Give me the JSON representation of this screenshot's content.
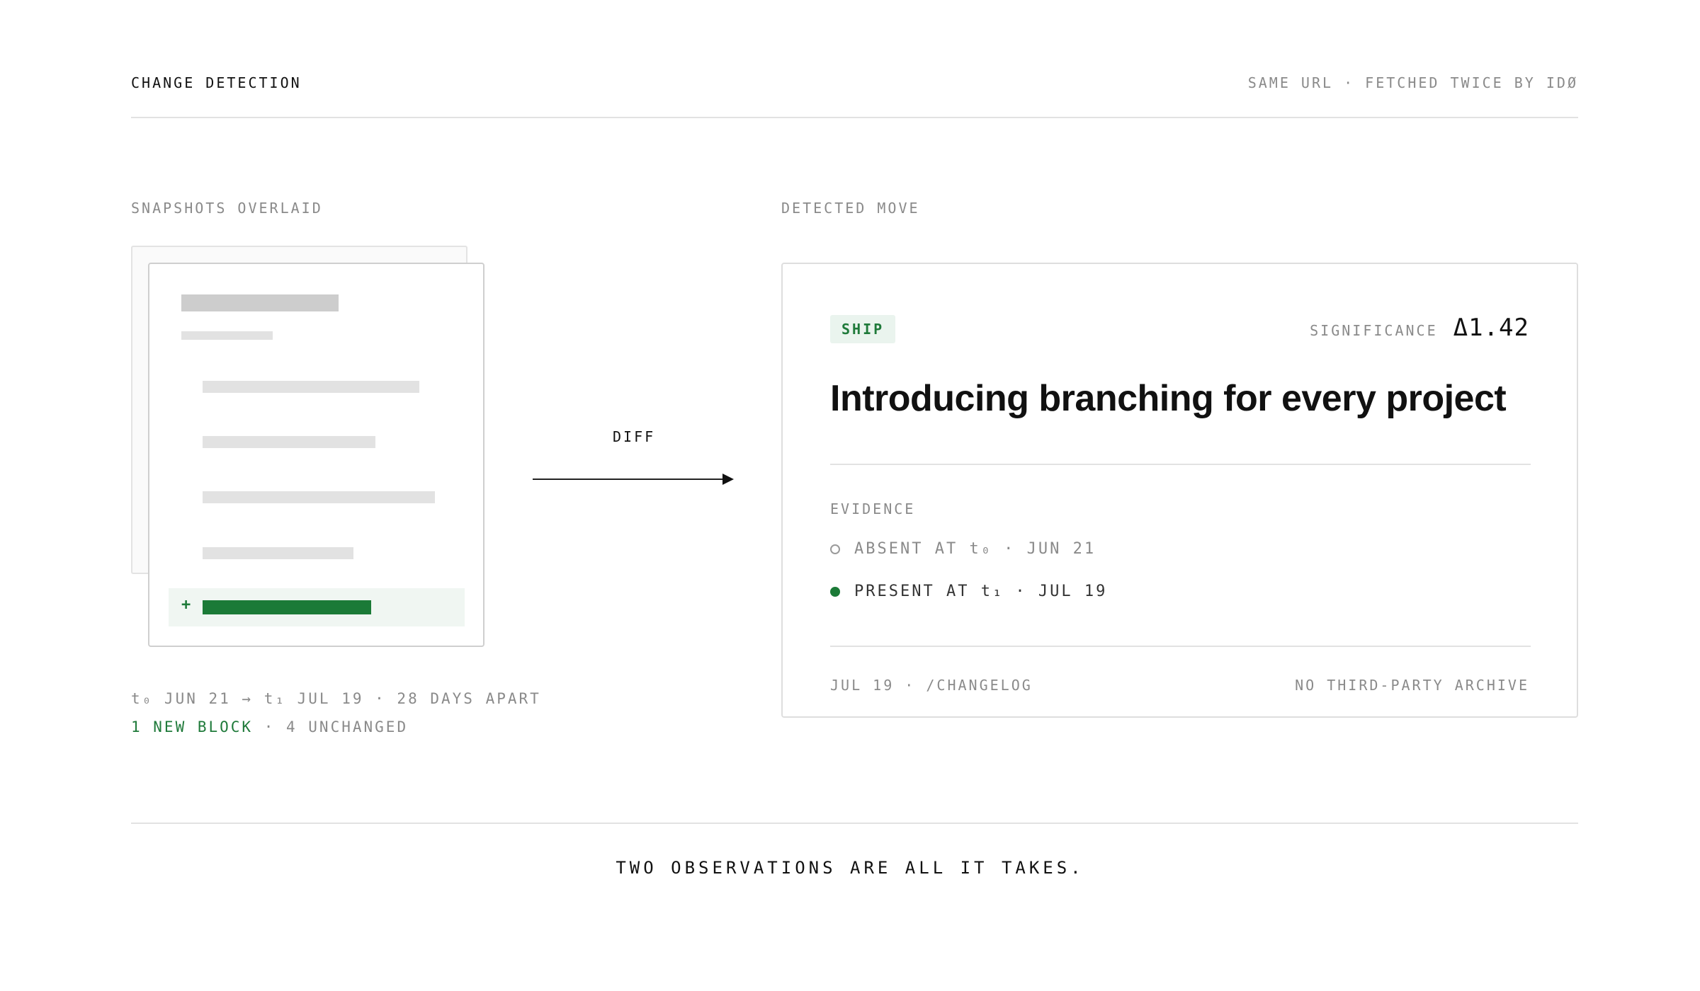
{
  "header": {
    "title": "CHANGE DETECTION",
    "subtitle": "SAME URL · FETCHED TWICE BY IDØ"
  },
  "left": {
    "label": "SNAPSHOTS OVERLAID",
    "meta_line1": "t₀ JUN 21 → t₁ JUL 19 · 28 DAYS APART",
    "new_block_text": "1 NEW BLOCK",
    "unchanged_text": " · 4 UNCHANGED",
    "new_block_marker": "+"
  },
  "diff": {
    "label": "DIFF"
  },
  "right": {
    "label": "DETECTED MOVE",
    "card": {
      "badge": "SHIP",
      "significance_label": "SIGNIFICANCE",
      "significance_value": "Δ1.42",
      "title": "Introducing branching for every project",
      "evidence_label": "EVIDENCE",
      "evidence": [
        {
          "text": "ABSENT AT t₀ · JUN 21",
          "state": "absent"
        },
        {
          "text": "PRESENT AT t₁ · JUL 19",
          "state": "present"
        }
      ],
      "footer_left": "JUL 19 · /CHANGELOG",
      "footer_right": "NO THIRD-PARTY ARCHIVE"
    }
  },
  "tagline": "TWO OBSERVATIONS ARE ALL IT TAKES.",
  "colors": {
    "accent_green": "#1b7a37",
    "badge_bg": "#eaf4ee",
    "muted_text": "#8a8a8a"
  }
}
